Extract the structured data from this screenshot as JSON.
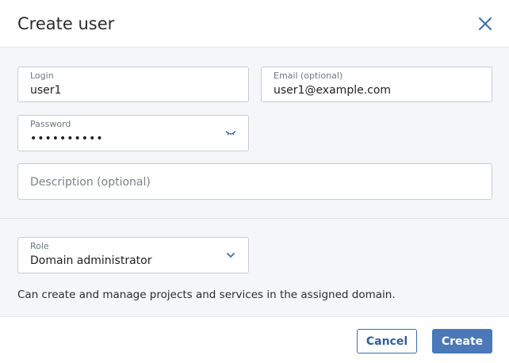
{
  "dialog": {
    "title": "Create user"
  },
  "form": {
    "login": {
      "label": "Login",
      "value": "user1"
    },
    "email": {
      "label": "Email (optional)",
      "value": "user1@example.com"
    },
    "password": {
      "label": "Password",
      "value": "••••••••••"
    },
    "description": {
      "placeholder": "Description (optional)"
    },
    "role": {
      "label": "Role",
      "value": "Domain administrator"
    },
    "role_help": "Can create and manage projects and services in the assigned domain."
  },
  "footer": {
    "cancel_label": "Cancel",
    "create_label": "Create"
  },
  "colors": {
    "accent": "#2f5f9e",
    "primary_button": "#4a78b8",
    "body_bg": "#f4f6f8"
  },
  "icons": {
    "close": "close-icon",
    "password_toggle": "eye-closed-icon",
    "role_dropdown": "chevron-down-icon"
  }
}
